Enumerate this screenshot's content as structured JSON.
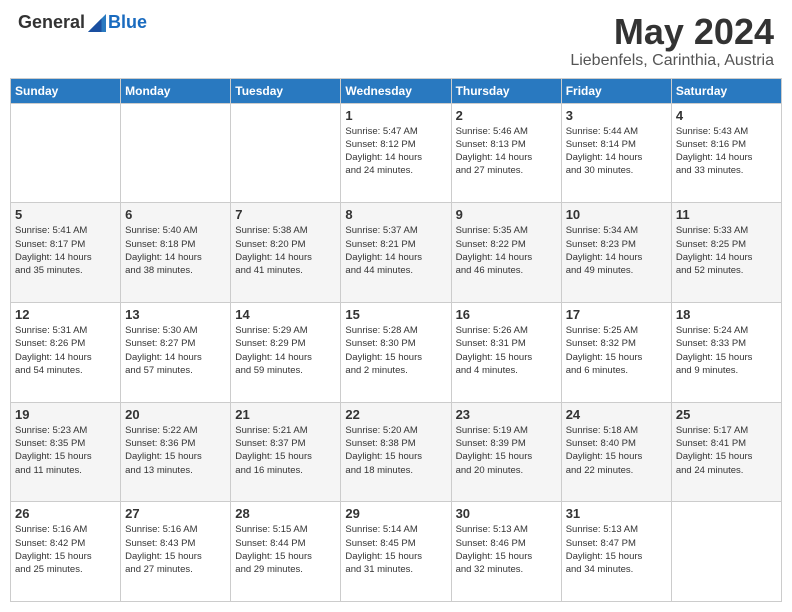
{
  "header": {
    "logo_general": "General",
    "logo_blue": "Blue",
    "title": "May 2024",
    "subtitle": "Liebenfels, Carinthia, Austria"
  },
  "columns": [
    "Sunday",
    "Monday",
    "Tuesday",
    "Wednesday",
    "Thursday",
    "Friday",
    "Saturday"
  ],
  "weeks": [
    [
      {
        "day": "",
        "info": ""
      },
      {
        "day": "",
        "info": ""
      },
      {
        "day": "",
        "info": ""
      },
      {
        "day": "1",
        "info": "Sunrise: 5:47 AM\nSunset: 8:12 PM\nDaylight: 14 hours\nand 24 minutes."
      },
      {
        "day": "2",
        "info": "Sunrise: 5:46 AM\nSunset: 8:13 PM\nDaylight: 14 hours\nand 27 minutes."
      },
      {
        "day": "3",
        "info": "Sunrise: 5:44 AM\nSunset: 8:14 PM\nDaylight: 14 hours\nand 30 minutes."
      },
      {
        "day": "4",
        "info": "Sunrise: 5:43 AM\nSunset: 8:16 PM\nDaylight: 14 hours\nand 33 minutes."
      }
    ],
    [
      {
        "day": "5",
        "info": "Sunrise: 5:41 AM\nSunset: 8:17 PM\nDaylight: 14 hours\nand 35 minutes."
      },
      {
        "day": "6",
        "info": "Sunrise: 5:40 AM\nSunset: 8:18 PM\nDaylight: 14 hours\nand 38 minutes."
      },
      {
        "day": "7",
        "info": "Sunrise: 5:38 AM\nSunset: 8:20 PM\nDaylight: 14 hours\nand 41 minutes."
      },
      {
        "day": "8",
        "info": "Sunrise: 5:37 AM\nSunset: 8:21 PM\nDaylight: 14 hours\nand 44 minutes."
      },
      {
        "day": "9",
        "info": "Sunrise: 5:35 AM\nSunset: 8:22 PM\nDaylight: 14 hours\nand 46 minutes."
      },
      {
        "day": "10",
        "info": "Sunrise: 5:34 AM\nSunset: 8:23 PM\nDaylight: 14 hours\nand 49 minutes."
      },
      {
        "day": "11",
        "info": "Sunrise: 5:33 AM\nSunset: 8:25 PM\nDaylight: 14 hours\nand 52 minutes."
      }
    ],
    [
      {
        "day": "12",
        "info": "Sunrise: 5:31 AM\nSunset: 8:26 PM\nDaylight: 14 hours\nand 54 minutes."
      },
      {
        "day": "13",
        "info": "Sunrise: 5:30 AM\nSunset: 8:27 PM\nDaylight: 14 hours\nand 57 minutes."
      },
      {
        "day": "14",
        "info": "Sunrise: 5:29 AM\nSunset: 8:29 PM\nDaylight: 14 hours\nand 59 minutes."
      },
      {
        "day": "15",
        "info": "Sunrise: 5:28 AM\nSunset: 8:30 PM\nDaylight: 15 hours\nand 2 minutes."
      },
      {
        "day": "16",
        "info": "Sunrise: 5:26 AM\nSunset: 8:31 PM\nDaylight: 15 hours\nand 4 minutes."
      },
      {
        "day": "17",
        "info": "Sunrise: 5:25 AM\nSunset: 8:32 PM\nDaylight: 15 hours\nand 6 minutes."
      },
      {
        "day": "18",
        "info": "Sunrise: 5:24 AM\nSunset: 8:33 PM\nDaylight: 15 hours\nand 9 minutes."
      }
    ],
    [
      {
        "day": "19",
        "info": "Sunrise: 5:23 AM\nSunset: 8:35 PM\nDaylight: 15 hours\nand 11 minutes."
      },
      {
        "day": "20",
        "info": "Sunrise: 5:22 AM\nSunset: 8:36 PM\nDaylight: 15 hours\nand 13 minutes."
      },
      {
        "day": "21",
        "info": "Sunrise: 5:21 AM\nSunset: 8:37 PM\nDaylight: 15 hours\nand 16 minutes."
      },
      {
        "day": "22",
        "info": "Sunrise: 5:20 AM\nSunset: 8:38 PM\nDaylight: 15 hours\nand 18 minutes."
      },
      {
        "day": "23",
        "info": "Sunrise: 5:19 AM\nSunset: 8:39 PM\nDaylight: 15 hours\nand 20 minutes."
      },
      {
        "day": "24",
        "info": "Sunrise: 5:18 AM\nSunset: 8:40 PM\nDaylight: 15 hours\nand 22 minutes."
      },
      {
        "day": "25",
        "info": "Sunrise: 5:17 AM\nSunset: 8:41 PM\nDaylight: 15 hours\nand 24 minutes."
      }
    ],
    [
      {
        "day": "26",
        "info": "Sunrise: 5:16 AM\nSunset: 8:42 PM\nDaylight: 15 hours\nand 25 minutes."
      },
      {
        "day": "27",
        "info": "Sunrise: 5:16 AM\nSunset: 8:43 PM\nDaylight: 15 hours\nand 27 minutes."
      },
      {
        "day": "28",
        "info": "Sunrise: 5:15 AM\nSunset: 8:44 PM\nDaylight: 15 hours\nand 29 minutes."
      },
      {
        "day": "29",
        "info": "Sunrise: 5:14 AM\nSunset: 8:45 PM\nDaylight: 15 hours\nand 31 minutes."
      },
      {
        "day": "30",
        "info": "Sunrise: 5:13 AM\nSunset: 8:46 PM\nDaylight: 15 hours\nand 32 minutes."
      },
      {
        "day": "31",
        "info": "Sunrise: 5:13 AM\nSunset: 8:47 PM\nDaylight: 15 hours\nand 34 minutes."
      },
      {
        "day": "",
        "info": ""
      }
    ]
  ]
}
